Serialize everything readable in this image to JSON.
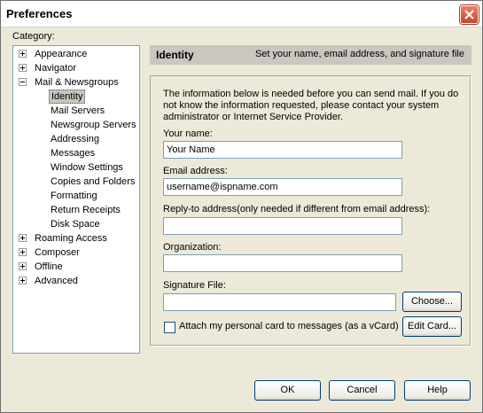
{
  "window": {
    "title": "Preferences"
  },
  "category": {
    "label": "Category:",
    "items": [
      {
        "label": "Appearance",
        "level": 0,
        "expander": "plus"
      },
      {
        "label": "Navigator",
        "level": 0,
        "expander": "plus"
      },
      {
        "label": "Mail & Newsgroups",
        "level": 0,
        "expander": "minus"
      },
      {
        "label": "Identity",
        "level": 1,
        "selected": true
      },
      {
        "label": "Mail Servers",
        "level": 1
      },
      {
        "label": "Newsgroup Servers",
        "level": 1
      },
      {
        "label": "Addressing",
        "level": 1
      },
      {
        "label": "Messages",
        "level": 1
      },
      {
        "label": "Window Settings",
        "level": 1
      },
      {
        "label": "Copies and Folders",
        "level": 1
      },
      {
        "label": "Formatting",
        "level": 1
      },
      {
        "label": "Return Receipts",
        "level": 1
      },
      {
        "label": "Disk Space",
        "level": 1
      },
      {
        "label": "Roaming Access",
        "level": 0,
        "expander": "plus"
      },
      {
        "label": "Composer",
        "level": 0,
        "expander": "plus"
      },
      {
        "label": "Offline",
        "level": 0,
        "expander": "plus"
      },
      {
        "label": "Advanced",
        "level": 0,
        "expander": "plus"
      }
    ]
  },
  "panel": {
    "title": "Identity",
    "description": "Set your name, email address, and signature file",
    "info": "The information below is needed before you can send mail.  If you do not know the information requested, please contact your system administrator or Internet Service Provider.",
    "your_name": {
      "label": "Your name:",
      "value": "Your Name"
    },
    "email": {
      "label": "Email address:",
      "value": "username@ispname.com"
    },
    "reply_to": {
      "label": "Reply-to address(only needed if different from email address):",
      "value": ""
    },
    "organization": {
      "label": "Organization:",
      "value": ""
    },
    "signature": {
      "label": "Signature File:",
      "value": "",
      "choose_label": "Choose..."
    },
    "vcard": {
      "label": "Attach my personal card to messages (as a vCard)",
      "checked": false,
      "edit_label": "Edit Card..."
    }
  },
  "buttons": {
    "ok": "OK",
    "cancel": "Cancel",
    "help": "Help"
  },
  "colors": {
    "close_button": "#c4462a",
    "header_bar": "#c9c7c0",
    "dialog_bg": "#ece9d8",
    "field_border": "#7f9db9"
  }
}
